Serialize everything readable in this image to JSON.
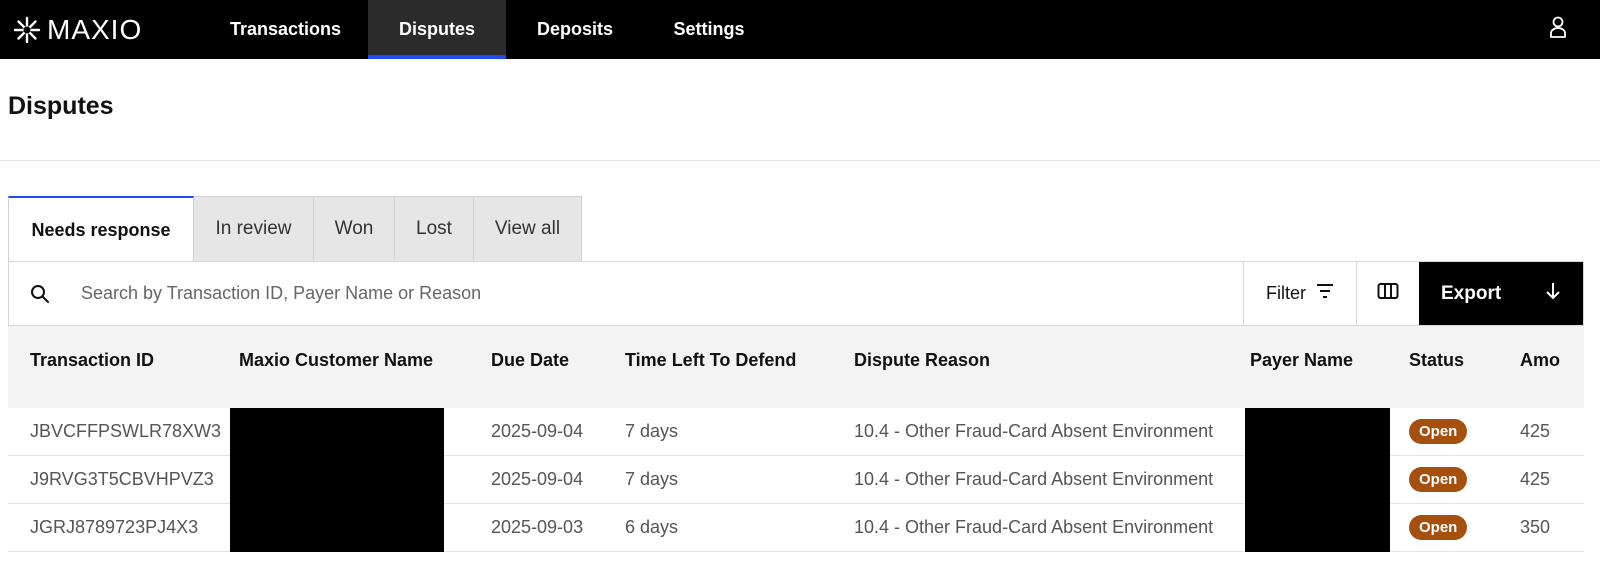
{
  "brand": {
    "name": "MAXIO"
  },
  "nav": {
    "items": [
      {
        "label": "Transactions"
      },
      {
        "label": "Disputes"
      },
      {
        "label": "Deposits"
      },
      {
        "label": "Settings"
      }
    ],
    "active": "Disputes"
  },
  "page": {
    "title": "Disputes"
  },
  "tabs": [
    {
      "label": "Needs response"
    },
    {
      "label": "In review"
    },
    {
      "label": "Won"
    },
    {
      "label": "Lost"
    },
    {
      "label": "View all"
    }
  ],
  "toolbar": {
    "search_placeholder": "Search by Transaction ID, Payer Name or Reason",
    "search_value": "",
    "filter_label": "Filter",
    "export_label": "Export"
  },
  "table": {
    "headers": {
      "transaction_id": "Transaction ID",
      "customer_name": "Maxio Customer Name",
      "due_date": "Due Date",
      "time_left": "Time Left To Defend",
      "dispute_reason": "Dispute Reason",
      "payer_name": "Payer Name",
      "status": "Status",
      "amount": "Amo"
    },
    "rows": [
      {
        "transaction_id": "JBVCFFPSWLR78XW3",
        "due_date": "2025-09-04",
        "time_left": "7 days",
        "dispute_reason": "10.4 - Other Fraud-Card Absent Environment",
        "status": "Open",
        "amount": "425"
      },
      {
        "transaction_id": "J9RVG3T5CBVHPVZ3",
        "due_date": "2025-09-04",
        "time_left": "7 days",
        "dispute_reason": "10.4 - Other Fraud-Card Absent Environment",
        "status": "Open",
        "amount": "425"
      },
      {
        "transaction_id": "JGRJ8789723PJ4X3",
        "due_date": "2025-09-03",
        "time_left": "6 days",
        "dispute_reason": "10.4 - Other Fraud-Card Absent Environment",
        "status": "Open",
        "amount": "350"
      }
    ]
  },
  "colors": {
    "nav_bg": "#000000",
    "accent": "#1f49ff",
    "status_open": "#a5500e",
    "export_bg": "#000000"
  },
  "icons": [
    "brand-logo-icon",
    "user-icon",
    "search-icon",
    "filter-icon",
    "columns-icon",
    "arrow-down-icon"
  ]
}
